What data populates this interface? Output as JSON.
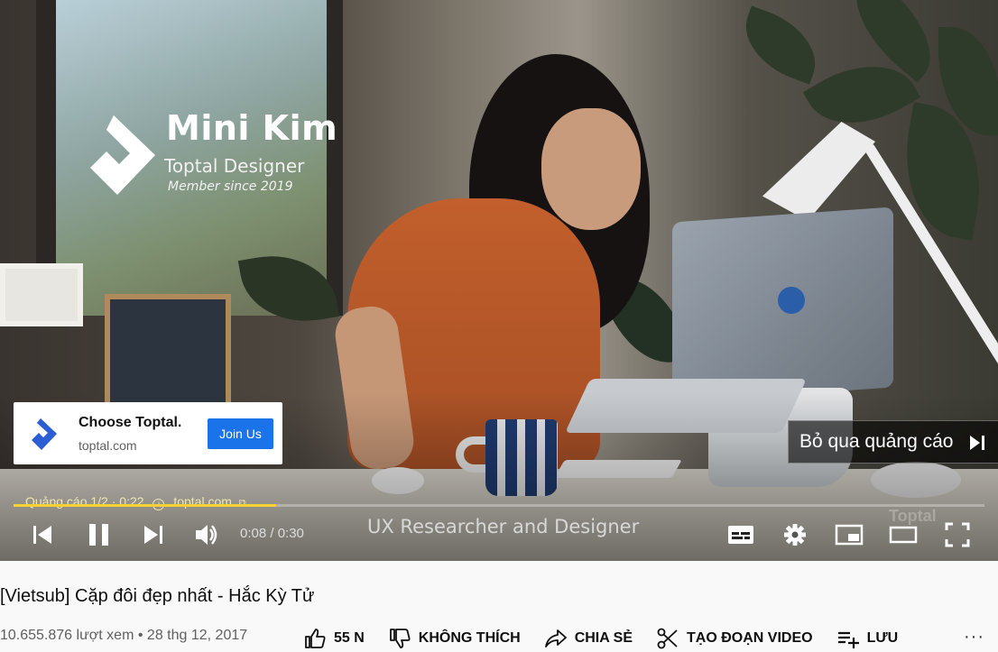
{
  "player": {
    "brand_overlay": {
      "name": "Mini Kim",
      "role": "Toptal Designer",
      "since": "Member since 2019"
    },
    "ad_card": {
      "title": "Choose Toptal.",
      "domain": "toptal.com",
      "cta_label": "Join Us",
      "accent_color": "#1a73e8"
    },
    "skip_label": "Bỏ qua quảng cáo",
    "ad_info": {
      "label": "Quảng cáo 1/2 · 0:22",
      "info_glyph": "i",
      "domain": "toptal.com"
    },
    "progress_fraction": 0.27,
    "progress_color": "#f7d034",
    "time_display": "0:08 / 0:30",
    "caption": "UX Researcher and Designer",
    "watermark": "Toptal"
  },
  "video": {
    "title": "[Vietsub] Cặp đôi đẹp nhất - Hắc Kỳ Tử",
    "views": "10.655.876 lượt xem",
    "separator": "•",
    "date": "28 thg 12, 2017"
  },
  "actions": {
    "like_count": "55 N",
    "dislike_label": "KHÔNG THÍCH",
    "share_label": "CHIA SẺ",
    "clip_label": "TẠO ĐOẠN VIDEO",
    "save_label": "LƯU",
    "more_glyph": "···"
  }
}
